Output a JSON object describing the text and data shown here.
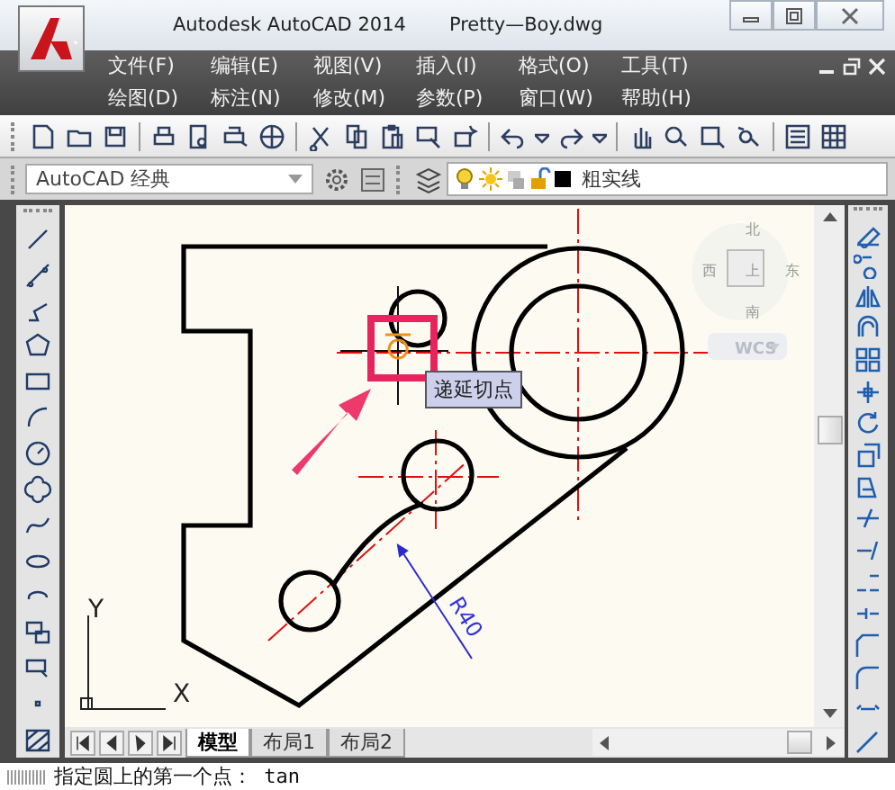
{
  "window": {
    "title": "Autodesk AutoCAD 2014",
    "file": "Pretty—Boy.dwg"
  },
  "menu_rows": [
    [
      "文件(F)",
      "编辑(E)",
      "视图(V)",
      "插入(I)",
      "格式(O)",
      "工具(T)"
    ],
    [
      "绘图(D)",
      "标注(N)",
      "修改(M)",
      "参数(P)",
      "窗口(W)",
      "帮助(H)"
    ]
  ],
  "workspace": {
    "value": "AutoCAD 经典"
  },
  "layer": {
    "name": "粗实线"
  },
  "viewcube": {
    "north": "北",
    "west": "西",
    "top": "上",
    "east": "东",
    "south": "南",
    "ucs": "WCS"
  },
  "tooltip": "递延切点",
  "dimension": "R40",
  "ucs_axes": {
    "y": "Y",
    "x": "X"
  },
  "layout_tabs": [
    {
      "label": "模型",
      "selected": true
    },
    {
      "label": "布局1",
      "selected": false
    },
    {
      "label": "布局2",
      "selected": false
    }
  ],
  "command_line": "指定圆上的第一个点： tan"
}
